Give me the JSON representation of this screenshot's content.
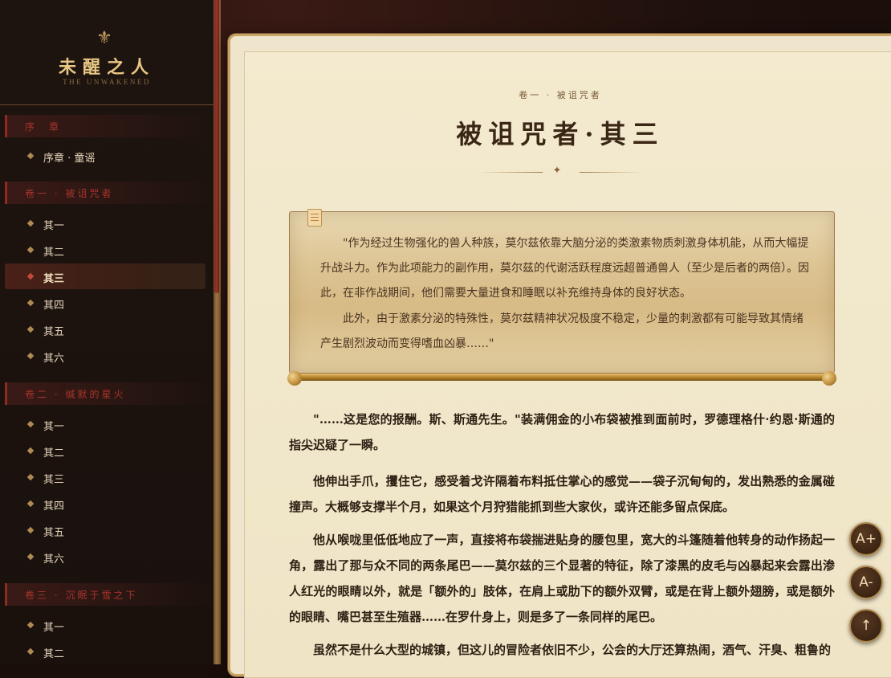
{
  "brand": {
    "title": "未醒之人",
    "subtitle": "THE UNWAKENED",
    "emblem_icon": "fleur-de-lis-icon"
  },
  "sidebar": {
    "volumes": [
      {
        "label": "序　章",
        "chapters": [
          "序章 · 童谣"
        ]
      },
      {
        "label": "卷一 · 被诅咒者",
        "chapters": [
          "其一",
          "其二",
          "其三",
          "其四",
          "其五",
          "其六"
        ],
        "active_chapter": "其三"
      },
      {
        "label": "卷二 · 缄默的星火",
        "chapters": [
          "其一",
          "其二",
          "其三",
          "其四",
          "其五",
          "其六"
        ]
      },
      {
        "label": "卷三 · 沉眠于雪之下",
        "chapters": [
          "其一",
          "其二"
        ]
      }
    ]
  },
  "chapter": {
    "breadcrumb": "卷一 · 被诅咒者",
    "title": "被诅咒者·其三",
    "ornament": "✦",
    "quote": [
      "\"作为经过生物强化的兽人种族，莫尔兹依靠大脑分泌的类激素物质刺激身体机能，从而大幅提升战斗力。作为此项能力的副作用，莫尔兹的代谢活跃程度远超普通兽人（至少是后者的两倍）。因此，在非作战期间，他们需要大量进食和睡眠以补充维持身体的良好状态。",
      "此外，由于激素分泌的特殊性，莫尔兹精神状况极度不稳定，少量的刺激都有可能导致其情绪产生剧烈波动而变得嗜血凶暴……\""
    ],
    "paragraphs": [
      "\"……这是您的报酬。斯、斯通先生。\"装满佣金的小布袋被推到面前时，罗德理格什·约恩·斯通的指尖迟疑了一瞬。",
      "他伸出手爪，攫住它，感受着戈许隔着布料抵住掌心的感觉——袋子沉甸甸的，发出熟悉的金属碰撞声。大概够支撑半个月，如果这个月狩猎能抓到些大家伙，或许还能多留点保底。",
      "他从喉咙里低低地应了一声，直接将布袋揣进贴身的腰包里，宽大的斗篷随着他转身的动作扬起一角，露出了那与众不同的两条尾巴——莫尔兹的三个显著的特征，除了漆黑的皮毛与凶暴起来会露出渗人红光的眼睛以外，就是「额外的」肢体，在肩上或肋下的额外双臂，或是在背上额外翅膀，或是额外的眼睛、嘴巴甚至生殖器……在罗什身上，则是多了一条同样的尾巴。",
      "虽然不是什么大型的城镇，但这儿的冒险者依旧不少，公会的大厅还算热闹，酒气、汗臭、粗鲁的"
    ]
  },
  "controls": {
    "font_increase": "A+",
    "font_decrease": "A-",
    "back_to_top": "↑"
  },
  "colors": {
    "accent_red": "#a8342c",
    "gold": "#c9a365",
    "parchment": "#efe5cc"
  }
}
